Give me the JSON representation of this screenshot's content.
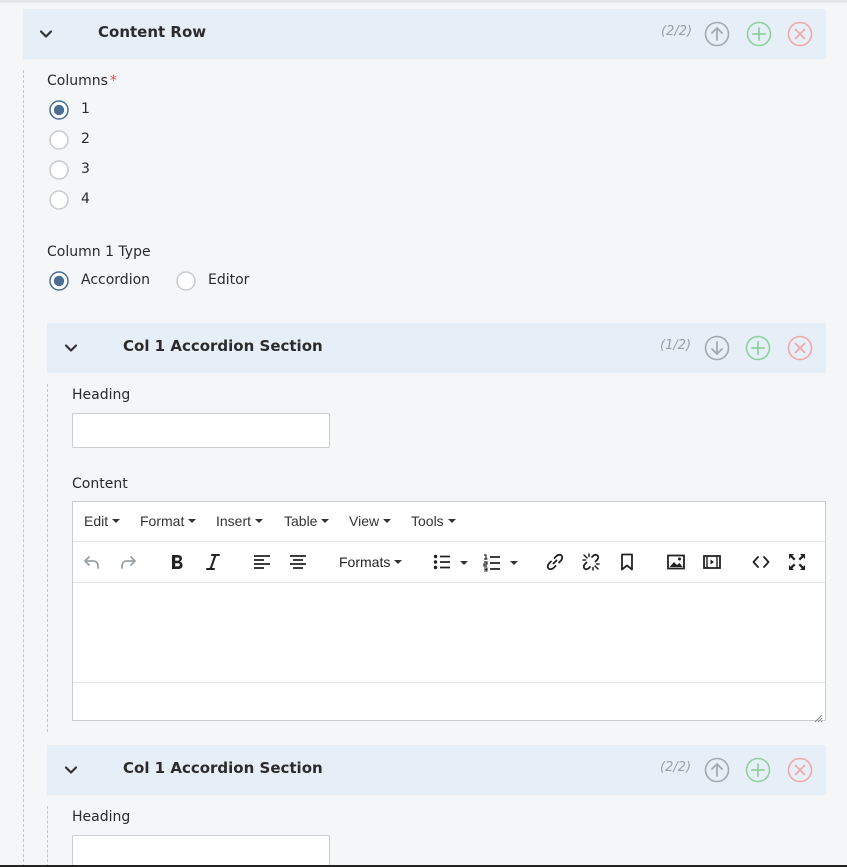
{
  "content_row": {
    "title": "Content Row",
    "counter": "(2/2)",
    "columns_label": "Columns",
    "required_mark": "*",
    "columns_options": [
      "1",
      "2",
      "3",
      "4"
    ],
    "columns_selected": "1",
    "column_type_label": "Column 1 Type",
    "column_type_options": [
      "Accordion",
      "Editor"
    ],
    "column_type_selected": "Accordion"
  },
  "sections": [
    {
      "title": "Col 1 Accordion Section",
      "counter": "(1/2)",
      "heading_label": "Heading",
      "heading_value": "",
      "content_label": "Content"
    },
    {
      "title": "Col 1 Accordion Section",
      "counter": "(2/2)",
      "heading_label": "Heading",
      "heading_value": ""
    }
  ],
  "editor": {
    "menus": [
      "Edit",
      "Format",
      "Insert",
      "Table",
      "View",
      "Tools"
    ],
    "formats_label": "Formats"
  },
  "colors": {
    "header_bg": "#e6eef7",
    "radio_selected": "#4a6e96",
    "add_green": "#8fd19e",
    "remove_red": "#f1a7a7",
    "move_gray": "#a4a9ae"
  },
  "icons": {
    "collapse": "chevron-down-icon",
    "move_up": "arrow-up-circle-icon",
    "move_down": "arrow-down-circle-icon",
    "add": "plus-circle-icon",
    "remove": "close-circle-icon"
  }
}
